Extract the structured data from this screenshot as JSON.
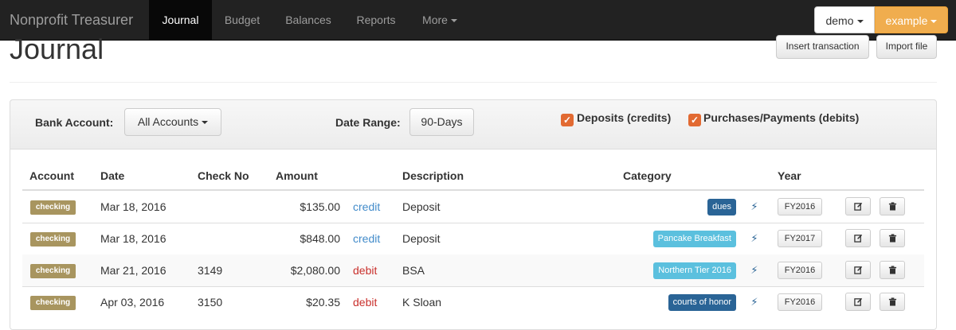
{
  "navbar": {
    "brand": "Nonprofit Treasurer",
    "items": [
      {
        "label": "Journal",
        "active": true
      },
      {
        "label": "Budget",
        "active": false
      },
      {
        "label": "Balances",
        "active": false
      },
      {
        "label": "Reports",
        "active": false
      },
      {
        "label": "More",
        "active": false,
        "dropdown": true
      }
    ],
    "user_button": "demo",
    "org_button": "example"
  },
  "header": {
    "title": "Journal",
    "insert_label": "Insert transaction",
    "import_label": "Import file"
  },
  "filters": {
    "bank_account_label": "Bank Account:",
    "bank_account_value": "All Accounts",
    "date_range_label": "Date Range:",
    "date_range_value": "90-Days",
    "deposits_label": "Deposits (credits)",
    "deposits_checked": true,
    "purchases_label": "Purchases/Payments (debits)",
    "purchases_checked": true
  },
  "table": {
    "columns": [
      "Account",
      "Date",
      "Check No",
      "Amount",
      "Description",
      "Category",
      "Year"
    ],
    "rows": [
      {
        "account": "checking",
        "date": "Mar 18, 2016",
        "check_no": "",
        "amount": "$135.00",
        "type": "credit",
        "description": "Deposit",
        "category": "dues",
        "category_style": "dark",
        "year": "FY2016"
      },
      {
        "account": "checking",
        "date": "Mar 18, 2016",
        "check_no": "",
        "amount": "$848.00",
        "type": "credit",
        "description": "Deposit",
        "category": "Pancake Breakfast",
        "category_style": "light",
        "year": "FY2017"
      },
      {
        "account": "checking",
        "date": "Mar 21, 2016",
        "check_no": "3149",
        "amount": "$2,080.00",
        "type": "debit",
        "description": "BSA",
        "category": "Northern Tier 2016",
        "category_style": "light",
        "year": "FY2016"
      },
      {
        "account": "checking",
        "date": "Apr 03, 2016",
        "check_no": "3150",
        "amount": "$20.35",
        "type": "debit",
        "description": "K Sloan",
        "category": "courts of honor",
        "category_style": "dark",
        "year": "FY2016"
      }
    ]
  },
  "colors": {
    "navbar_bg": "#222222",
    "accent_orange": "#f0ad4e",
    "account_badge": "#a8955f",
    "category_dark": "#2a6496",
    "category_light": "#5bc0de",
    "credit_text": "#428bca",
    "debit_text": "#c9302c",
    "checkbox": "#e26a32"
  },
  "icons": {
    "category_action": "bolt-icon",
    "edit": "edit-icon",
    "delete": "trash-icon",
    "checkbox": "check-icon"
  }
}
